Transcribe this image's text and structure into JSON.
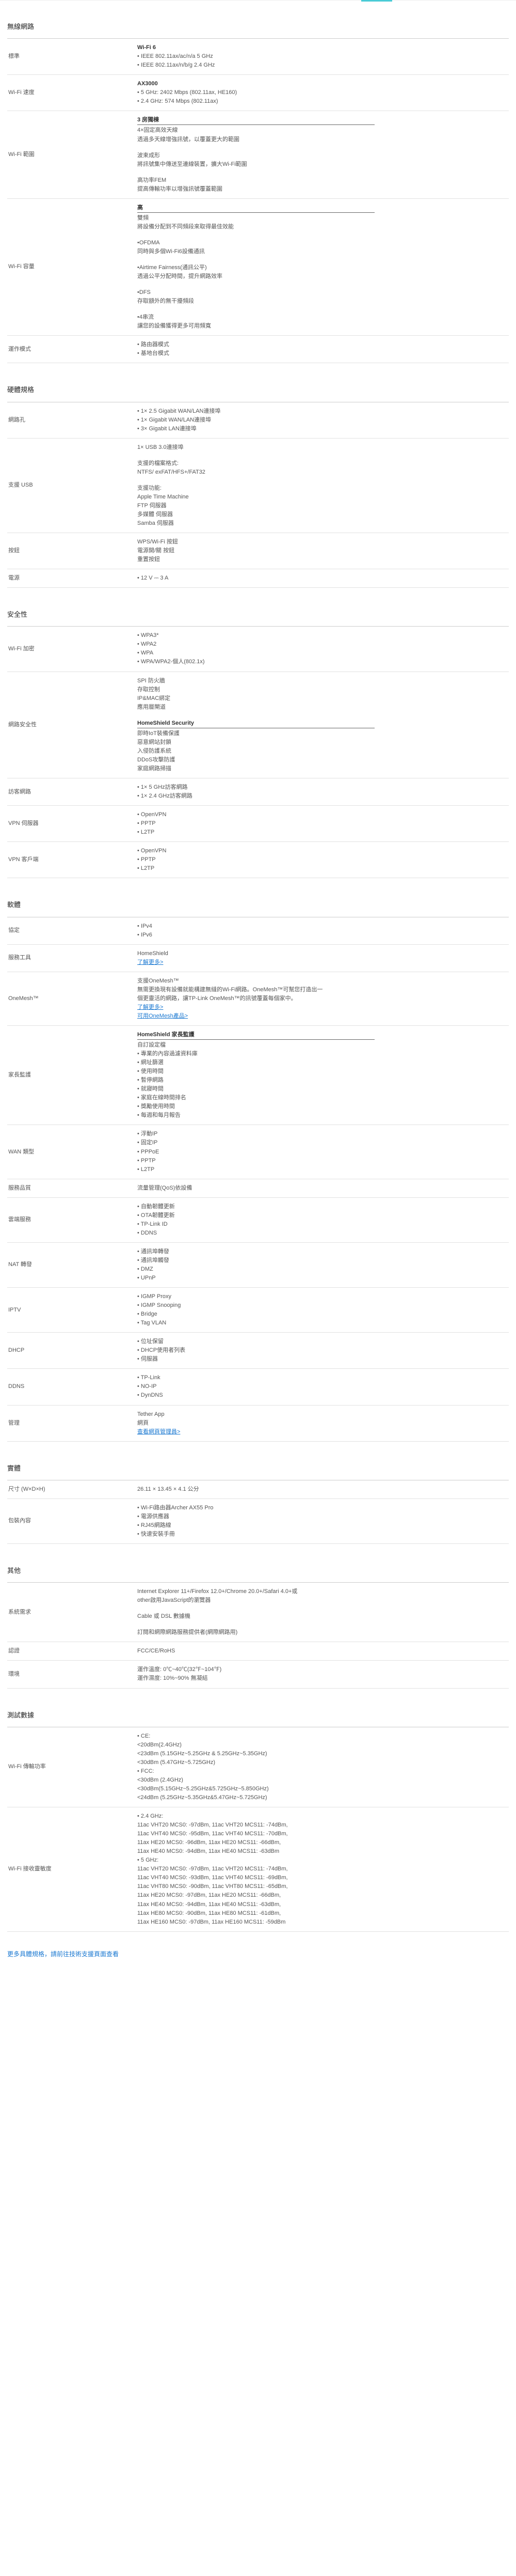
{
  "sections": [
    {
      "title": "無線網路",
      "rows": [
        {
          "label": "標準",
          "lines": [
            {
              "t": "head",
              "text": "Wi-Fi 6"
            },
            {
              "t": "text",
              "text": "• IEEE 802.11ax/ac/n/a 5 GHz"
            },
            {
              "t": "text",
              "text": "• IEEE 802.11ax/n/b/g 2.4 GHz"
            }
          ]
        },
        {
          "label": "Wi-Fi 速度",
          "lines": [
            {
              "t": "head",
              "text": "AX3000"
            },
            {
              "t": "text",
              "text": "• 5 GHz: 2402 Mbps (802.11ax, HE160)"
            },
            {
              "t": "text",
              "text": "• 2.4 GHz: 574 Mbps (802.11ax)"
            }
          ]
        },
        {
          "label": "Wi-Fi 範圍",
          "lines": [
            {
              "t": "underhead",
              "text": "3 房獨棟"
            },
            {
              "t": "text",
              "text": "4×固定高效天線"
            },
            {
              "t": "text",
              "text": "透過多天線增強訊號，以覆蓋更大的範圍"
            },
            {
              "t": "gap"
            },
            {
              "t": "text",
              "text": "波束成形"
            },
            {
              "t": "text",
              "text": "將訊號集中傳送至連線裝置，擴大Wi-Fi範圍"
            },
            {
              "t": "gap"
            },
            {
              "t": "text",
              "text": "高功率FEM"
            },
            {
              "t": "text",
              "text": "提高傳輸功率以增強訊號覆蓋範圍"
            }
          ]
        },
        {
          "label": "Wi-Fi 容量",
          "lines": [
            {
              "t": "underhead",
              "text": "高"
            },
            {
              "t": "text",
              "text": "雙頻"
            },
            {
              "t": "text",
              "text": "將設備分配到不同頻段來取得最佳效能"
            },
            {
              "t": "gap"
            },
            {
              "t": "text",
              "text": "•OFDMA"
            },
            {
              "t": "text",
              "text": "同時與多個Wi-Fi6設備通訊"
            },
            {
              "t": "gap"
            },
            {
              "t": "text",
              "text": "•Airtime Fairness(通訊公平)"
            },
            {
              "t": "text",
              "text": "透過公平分配時間，提升網路效率"
            },
            {
              "t": "gap"
            },
            {
              "t": "text",
              "text": "•DFS"
            },
            {
              "t": "text",
              "text": "存取額外的無干擾頻段"
            },
            {
              "t": "gap"
            },
            {
              "t": "text",
              "text": "•4串流"
            },
            {
              "t": "text",
              "text": "讓您的設備獲得更多可用頻寬"
            }
          ]
        },
        {
          "label": "運作模式",
          "lines": [
            {
              "t": "text",
              "text": "• 路由器模式"
            },
            {
              "t": "text",
              "text": "• 基地台模式"
            }
          ]
        }
      ]
    },
    {
      "title": "硬體規格",
      "rows": [
        {
          "label": "網路孔",
          "lines": [
            {
              "t": "text",
              "text": "• 1× 2.5 Gigabit WAN/LAN連接埠"
            },
            {
              "t": "text",
              "text": "• 1× Gigabit WAN/LAN連接埠"
            },
            {
              "t": "text",
              "text": "• 3× Gigabit LAN連接埠"
            }
          ]
        },
        {
          "label": "支援 USB",
          "lines": [
            {
              "t": "text",
              "text": "1× USB 3.0連接埠"
            },
            {
              "t": "gap"
            },
            {
              "t": "text",
              "text": "支援的檔案格式:"
            },
            {
              "t": "text",
              "text": "NTFS/ exFAT/HFS+/FAT32"
            },
            {
              "t": "gap"
            },
            {
              "t": "text",
              "text": "支援功能:"
            },
            {
              "t": "text",
              "text": "Apple Time Machine"
            },
            {
              "t": "text",
              "text": "FTP 伺服器"
            },
            {
              "t": "text",
              "text": "多媒體 伺服器"
            },
            {
              "t": "text",
              "text": "Samba 伺服器"
            }
          ]
        },
        {
          "label": "按鈕",
          "lines": [
            {
              "t": "text",
              "text": "WPS/Wi-Fi 按鈕"
            },
            {
              "t": "text",
              "text": "電源開/關 按鈕"
            },
            {
              "t": "text",
              "text": "重置按鈕"
            }
          ]
        },
        {
          "label": "電源",
          "lines": [
            {
              "t": "text",
              "text": "• 12 V ⎓ 3 A"
            }
          ]
        }
      ]
    },
    {
      "title": "安全性",
      "rows": [
        {
          "label": "Wi-Fi 加密",
          "lines": [
            {
              "t": "text",
              "text": "• WPA3*"
            },
            {
              "t": "text",
              "text": "• WPA2"
            },
            {
              "t": "text",
              "text": "• WPA"
            },
            {
              "t": "text",
              "text": "• WPA/WPA2-個人(802.1x)"
            }
          ]
        },
        {
          "label": "網路安全性",
          "lines": [
            {
              "t": "text",
              "text": "SPI 防火牆"
            },
            {
              "t": "text",
              "text": "存取控制"
            },
            {
              "t": "text",
              "text": "IP&MAC綁定"
            },
            {
              "t": "text",
              "text": "應用層閘道"
            },
            {
              "t": "gap"
            },
            {
              "t": "underhead",
              "text": "HomeShield Security"
            },
            {
              "t": "text",
              "text": "即時IoT裝備保護"
            },
            {
              "t": "text",
              "text": "惡意網站封鎖"
            },
            {
              "t": "text",
              "text": "入侵防護系統"
            },
            {
              "t": "text",
              "text": "DDoS攻擊防護"
            },
            {
              "t": "text",
              "text": "家庭網路掃描"
            }
          ]
        },
        {
          "label": "訪客網路",
          "lines": [
            {
              "t": "text",
              "text": "• 1× 5 GHz訪客網路"
            },
            {
              "t": "text",
              "text": "• 1× 2.4 GHz訪客網路"
            }
          ]
        },
        {
          "label": "VPN 伺服器",
          "lines": [
            {
              "t": "text",
              "text": "• OpenVPN"
            },
            {
              "t": "text",
              "text": "• PPTP"
            },
            {
              "t": "text",
              "text": "• L2TP"
            }
          ]
        },
        {
          "label": "VPN 客戶端",
          "lines": [
            {
              "t": "text",
              "text": "• OpenVPN"
            },
            {
              "t": "text",
              "text": "• PPTP"
            },
            {
              "t": "text",
              "text": "• L2TP"
            }
          ]
        }
      ]
    },
    {
      "title": "軟體",
      "rows": [
        {
          "label": "協定",
          "lines": [
            {
              "t": "text",
              "text": "• IPv4"
            },
            {
              "t": "text",
              "text": "• IPv6"
            }
          ]
        },
        {
          "label": "服務工具",
          "lines": [
            {
              "t": "text",
              "text": "HomeShield"
            },
            {
              "t": "link",
              "text": "了解更多>"
            }
          ]
        },
        {
          "label": "OneMesh™",
          "lines": [
            {
              "t": "text",
              "text": "支援OneMesh™"
            },
            {
              "t": "text",
              "text": "無需更換現有設備就能構建無縫的Wi-Fi網路。OneMesh™可幫您打造出一"
            },
            {
              "t": "text",
              "text": "個更靈活的網路，讓TP-Link OneMesh™的訊號覆蓋每個家中。"
            },
            {
              "t": "link",
              "text": "了解更多>"
            },
            {
              "t": "link",
              "text": "可用OneMesh產品>"
            }
          ]
        },
        {
          "label": "家長監護",
          "lines": [
            {
              "t": "underhead",
              "text": "HomeShield 家長監護"
            },
            {
              "t": "text",
              "text": "自訂設定檔"
            },
            {
              "t": "text",
              "text": "• 專業的內容過濾資料庫"
            },
            {
              "t": "text",
              "text": "• 網址篩選"
            },
            {
              "t": "text",
              "text": "• 使用時間"
            },
            {
              "t": "text",
              "text": "• 暫停網路"
            },
            {
              "t": "text",
              "text": "• 就寢時間"
            },
            {
              "t": "text",
              "text": "• 家庭在線時間排名"
            },
            {
              "t": "text",
              "text": "• 獎勵使用時間"
            },
            {
              "t": "text",
              "text": "• 每週和每月報告"
            }
          ]
        },
        {
          "label": "WAN 類型",
          "lines": [
            {
              "t": "text",
              "text": "• 浮動IP"
            },
            {
              "t": "text",
              "text": "• 固定IP"
            },
            {
              "t": "text",
              "text": "• PPPoE"
            },
            {
              "t": "text",
              "text": "• PPTP"
            },
            {
              "t": "text",
              "text": "• L2TP"
            }
          ]
        },
        {
          "label": "服務品質",
          "lines": [
            {
              "t": "text",
              "text": "流量管理(QoS)依設備"
            }
          ]
        },
        {
          "label": "雲端服務",
          "lines": [
            {
              "t": "text",
              "text": "• 自動韌體更新"
            },
            {
              "t": "text",
              "text": "• OTA韌體更新"
            },
            {
              "t": "text",
              "text": "• TP-Link ID"
            },
            {
              "t": "text",
              "text": "• DDNS"
            }
          ]
        },
        {
          "label": "NAT 轉發",
          "lines": [
            {
              "t": "text",
              "text": "• 通訊埠轉發"
            },
            {
              "t": "text",
              "text": "• 通訊埠觸發"
            },
            {
              "t": "text",
              "text": "• DMZ"
            },
            {
              "t": "text",
              "text": "• UPnP"
            }
          ]
        },
        {
          "label": "IPTV",
          "lines": [
            {
              "t": "text",
              "text": "• IGMP Proxy"
            },
            {
              "t": "text",
              "text": "• IGMP Snooping"
            },
            {
              "t": "text",
              "text": "• Bridge"
            },
            {
              "t": "text",
              "text": "• Tag VLAN"
            }
          ]
        },
        {
          "label": "DHCP",
          "lines": [
            {
              "t": "text",
              "text": "• 位址保留"
            },
            {
              "t": "text",
              "text": "• DHCP使用者列表"
            },
            {
              "t": "text",
              "text": "• 伺服器"
            }
          ]
        },
        {
          "label": "DDNS",
          "lines": [
            {
              "t": "text",
              "text": "• TP-Link"
            },
            {
              "t": "text",
              "text": "• NO-IP"
            },
            {
              "t": "text",
              "text": "• DynDNS"
            }
          ]
        },
        {
          "label": "管理",
          "lines": [
            {
              "t": "text",
              "text": "Tether App"
            },
            {
              "t": "text",
              "text": "網頁"
            },
            {
              "t": "link",
              "text": "查看網頁管理員>"
            }
          ]
        }
      ]
    },
    {
      "title": "實體",
      "rows": [
        {
          "label": "尺寸 (W×D×H)",
          "lines": [
            {
              "t": "text",
              "text": "26.11 × 13.45 × 4.1 公分"
            }
          ]
        },
        {
          "label": "包裝內容",
          "lines": [
            {
              "t": "text",
              "text": "• Wi-Fi路由器Archer AX55 Pro"
            },
            {
              "t": "text",
              "text": "• 電源供應器"
            },
            {
              "t": "text",
              "text": "• RJ45網路線"
            },
            {
              "t": "text",
              "text": "• 快速安裝手冊"
            }
          ]
        }
      ]
    },
    {
      "title": "其他",
      "rows": [
        {
          "label": "系統需求",
          "lines": [
            {
              "t": "text",
              "text": "Internet Explorer 11+/Firefox 12.0+/Chrome 20.0+/Safari 4.0+或"
            },
            {
              "t": "text",
              "text": "other啟用JavaScript的瀏覽器"
            },
            {
              "t": "gap"
            },
            {
              "t": "text",
              "text": "Cable 或 DSL 數據機"
            },
            {
              "t": "gap"
            },
            {
              "t": "text",
              "text": "訂閱和網際網路服務提供者(網際網路用)"
            }
          ]
        },
        {
          "label": "認證",
          "lines": [
            {
              "t": "text",
              "text": "FCC/CE/RoHS"
            }
          ]
        },
        {
          "label": "環境",
          "lines": [
            {
              "t": "text",
              "text": "運作溫度: 0℃~40℃(32℉~104℉)"
            },
            {
              "t": "text",
              "text": "運作濕度: 10%~90% 無凝結"
            }
          ]
        }
      ]
    },
    {
      "title": "測試數據",
      "rows": [
        {
          "label": "Wi-Fi 傳輸功率",
          "lines": [
            {
              "t": "text",
              "text": "• CE:"
            },
            {
              "t": "text",
              "text": "<20dBm(2.4GHz)"
            },
            {
              "t": "text",
              "text": "<23dBm (5.15GHz~5.25GHz & 5.25GHz~5.35GHz)"
            },
            {
              "t": "text",
              "text": "<30dBm (5.47GHz~5.725GHz)"
            },
            {
              "t": "text",
              "text": "• FCC:"
            },
            {
              "t": "text",
              "text": "<30dBm (2.4GHz)"
            },
            {
              "t": "text",
              "text": "<30dBm(5.15GHz~5.25GHz&5.725GHz~5.850GHz)"
            },
            {
              "t": "text",
              "text": "<24dBm (5.25GHz~5.35GHz&5.47GHz~5.725GHz)"
            }
          ]
        },
        {
          "label": "Wi-Fi 接收靈敏度",
          "lines": [
            {
              "t": "text",
              "text": "• 2.4 GHz:"
            },
            {
              "t": "text",
              "text": "11ac VHT20 MCS0: -97dBm, 11ac VHT20 MCS11: -74dBm,"
            },
            {
              "t": "text",
              "text": "11ac VHT40 MCS0: -95dBm, 11ac VHT40 MCS11: -70dBm,"
            },
            {
              "t": "text",
              "text": "11ax HE20 MCS0: -96dBm, 11ax HE20 MCS11: -66dBm,"
            },
            {
              "t": "text",
              "text": "11ax HE40 MCS0: -94dBm, 11ax HE40 MCS11: -63dBm"
            },
            {
              "t": "text",
              "text": "• 5 GHz:"
            },
            {
              "t": "text",
              "text": "11ac VHT20 MCS0: -97dBm, 11ac VHT20 MCS11: -74dBm,"
            },
            {
              "t": "text",
              "text": "11ac VHT40 MCS0: -93dBm, 11ac VHT40 MCS11: -69dBm,"
            },
            {
              "t": "text",
              "text": "11ac VHT80 MCS0: -90dBm, 11ac VHT80 MCS11: -65dBm,"
            },
            {
              "t": "text",
              "text": "11ax HE20 MCS0: -97dBm, 11ax HE20 MCS11: -66dBm,"
            },
            {
              "t": "text",
              "text": "11ax HE40 MCS0: -94dBm, 11ax HE40 MCS11: -63dBm,"
            },
            {
              "t": "text",
              "text": "11ax HE80 MCS0: -90dBm, 11ax HE80 MCS11: -61dBm,"
            },
            {
              "t": "text",
              "text": "11ax HE160 MCS0: -97dBm, 11ax HE160 MCS11: -59dBm"
            }
          ]
        }
      ]
    }
  ],
  "footer": {
    "link_text": "更多具體規格，請前往技術支援頁面查看"
  },
  "colors": {
    "accent": "#4acbd6",
    "link": "#1a78d1"
  }
}
